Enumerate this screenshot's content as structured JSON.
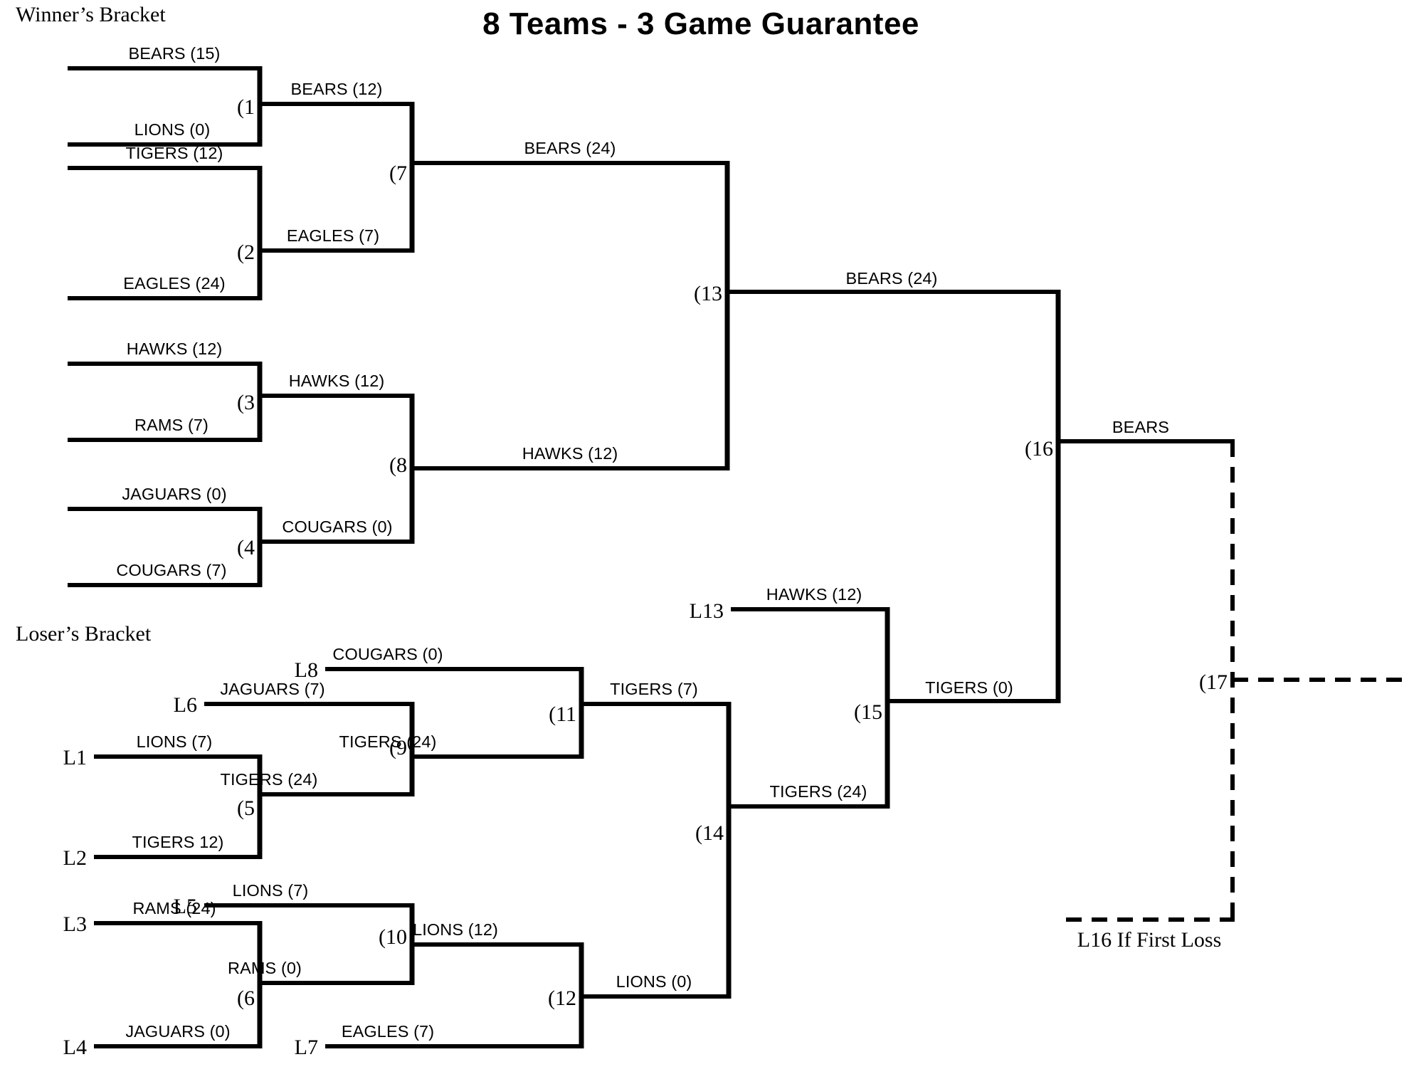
{
  "title": "8 Teams - 3 Game Guarantee",
  "sections": {
    "winners_label": "Winner’s Bracket",
    "losers_label": "Loser’s Bracket"
  },
  "footnote": "L16 If First Loss",
  "colors": {
    "line": "#000000",
    "text": "#000000",
    "background": "#ffffff"
  },
  "chart_data": {
    "type": "diagram",
    "subtype": "double-elimination-bracket",
    "title": "8 Teams - 3 Game Guarantee",
    "teams": [
      "BEARS",
      "LIONS",
      "TIGERS",
      "EAGLES",
      "HAWKS",
      "RAMS",
      "JAGUARS",
      "COUGARS"
    ],
    "champion": "BEARS",
    "games": [
      {
        "id": 1,
        "bracket": "winners",
        "label": "(1",
        "participants": [
          "BEARS (15)",
          "LIONS (0)"
        ],
        "winner": "BEARS (12)"
      },
      {
        "id": 2,
        "bracket": "winners",
        "label": "(2",
        "participants": [
          "TIGERS (12)",
          "EAGLES (24)"
        ],
        "winner": "EAGLES (7)"
      },
      {
        "id": 3,
        "bracket": "winners",
        "label": "(3",
        "participants": [
          "HAWKS (12)",
          "RAMS (7)"
        ],
        "winner": "HAWKS (12)"
      },
      {
        "id": 4,
        "bracket": "winners",
        "label": "(4",
        "participants": [
          "JAGUARS (0)",
          "COUGARS (7)"
        ],
        "winner": "COUGARS (0)"
      },
      {
        "id": 7,
        "bracket": "winners",
        "label": "(7",
        "participants": [
          "BEARS (12)",
          "EAGLES (7)"
        ],
        "winner": "BEARS (24)"
      },
      {
        "id": 8,
        "bracket": "winners",
        "label": "(8",
        "participants": [
          "HAWKS (12)",
          "COUGARS (0)"
        ],
        "winner": "HAWKS (12)"
      },
      {
        "id": 13,
        "bracket": "winners",
        "label": "(13",
        "participants": [
          "BEARS (24)",
          "HAWKS (12)"
        ],
        "winner": "BEARS (24)"
      },
      {
        "id": 5,
        "bracket": "losers",
        "label": "(5",
        "participants": [
          "LIONS (7)",
          "TIGERS 12)"
        ],
        "seeds": [
          "L1",
          "L2"
        ],
        "winner": "TIGERS (24)"
      },
      {
        "id": 6,
        "bracket": "losers",
        "label": "(6",
        "participants": [
          "RAMS (24)",
          "JAGUARS (0)"
        ],
        "seeds": [
          "L3",
          "L4"
        ],
        "winner": "RAMS (0)"
      },
      {
        "id": 9,
        "bracket": "losers",
        "label": "(9",
        "participants": [
          "JAGUARS (7)",
          "TIGERS (24)"
        ],
        "seeds": [
          "L6",
          null
        ],
        "winner": "TIGERS (24)"
      },
      {
        "id": 10,
        "bracket": "losers",
        "label": "(10",
        "participants": [
          "LIONS (7)",
          "RAMS (0)"
        ],
        "seeds": [
          "L5",
          null
        ],
        "winner": "LIONS (12)"
      },
      {
        "id": 11,
        "bracket": "losers",
        "label": "(11",
        "participants": [
          "COUGARS (0)",
          "TIGERS (24)"
        ],
        "seeds": [
          "L8",
          null
        ],
        "winner": "TIGERS (7)"
      },
      {
        "id": 12,
        "bracket": "losers",
        "label": "(12",
        "participants": [
          "LIONS (12)",
          "EAGLES (7)"
        ],
        "seeds": [
          null,
          "L7"
        ],
        "winner": "LIONS (0)"
      },
      {
        "id": 14,
        "bracket": "losers",
        "label": "(14",
        "participants": [
          "TIGERS (7)",
          "LIONS (0)"
        ],
        "winner": "TIGERS (24)"
      },
      {
        "id": 15,
        "bracket": "losers",
        "label": "(15",
        "participants": [
          "HAWKS (12)",
          "TIGERS (24)"
        ],
        "seeds": [
          "L13",
          null
        ],
        "winner": "TIGERS (0)"
      },
      {
        "id": 16,
        "bracket": "final",
        "label": "(16",
        "participants": [
          "BEARS (24)",
          "TIGERS (0)"
        ],
        "winner": "BEARS"
      },
      {
        "id": 17,
        "bracket": "final",
        "label": "(17",
        "participants": [
          "BEARS",
          "L16 If First Loss"
        ],
        "winner": null,
        "conditional": true
      }
    ]
  },
  "labels": {
    "g1_num": "(1",
    "g1_top": "BEARS (15)",
    "g1_bot": "LIONS (0)",
    "g2_num": "(2",
    "g2_top": "TIGERS (12)",
    "g2_bot": "EAGLES (24)",
    "g3_num": "(3",
    "g3_top": "HAWKS (12)",
    "g3_bot": "RAMS (7)",
    "g4_num": "(4",
    "g4_top": "JAGUARS (0)",
    "g4_bot": "COUGARS (7)",
    "g7_num": "(7",
    "g7_top": "BEARS (12)",
    "g7_bot": "EAGLES (7)",
    "g8_num": "(8",
    "g8_top": "HAWKS (12)",
    "g8_bot": "COUGARS (0)",
    "g13_num": "(13",
    "g13_top": "BEARS (24)",
    "g13_bot": "HAWKS (12)",
    "g5_num": "(5",
    "g5_top": "LIONS (7)",
    "g5_bot": "TIGERS 12)",
    "g5_seed_top": "L1",
    "g5_seed_bot": "L2",
    "g6_num": "(6",
    "g6_top": "RAMS (24)",
    "g6_bot": "JAGUARS (0)",
    "g6_seed_top": "L3",
    "g6_seed_bot": "L4",
    "g9_num": "(9",
    "g9_top": "JAGUARS (7)",
    "g9_bot": "TIGERS (24)",
    "g9_seed_top": "L6",
    "g10_num": "(10",
    "g10_top": "LIONS (7)",
    "g10_bot": "RAMS (0)",
    "g10_seed_top": "L5",
    "g11_num": "(11",
    "g11_top": "COUGARS (0)",
    "g11_bot": "TIGERS (24)",
    "g11_seed_top": "L8",
    "g12_num": "(12",
    "g12_top": "LIONS (12)",
    "g12_bot": "EAGLES (7)",
    "g12_seed_bot": "L7",
    "g14_num": "(14",
    "g14_top": "TIGERS (7)",
    "g14_bot": "LIONS (0)",
    "g15_num": "(15",
    "g15_top": "HAWKS (12)",
    "g15_bot": "TIGERS (24)",
    "g15_seed_top": "L13",
    "g16_num": "(16",
    "g16_top": "BEARS (24)",
    "g16_bot": "TIGERS (0)",
    "g16_win": "BEARS",
    "g17_num": "(17"
  }
}
